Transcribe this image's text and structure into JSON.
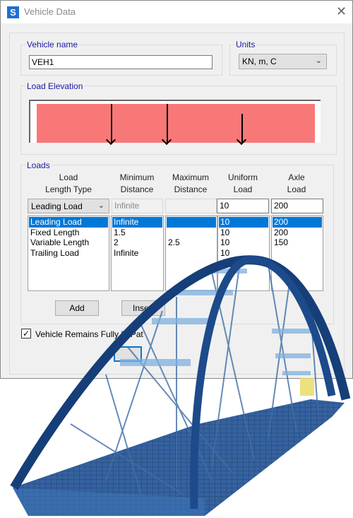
{
  "window": {
    "title": "Vehicle Data",
    "app_icon_letter": "S",
    "close_glyph": "✕"
  },
  "vehicle_name": {
    "label": "Vehicle name",
    "value": "VEH1"
  },
  "units": {
    "label": "Units",
    "value": "KN, m, C"
  },
  "load_elevation": {
    "label": "Load Elevation",
    "fill_color": "#f87878"
  },
  "loads": {
    "label": "Loads",
    "headers": {
      "type": [
        "Load",
        "Length Type"
      ],
      "min": [
        "Minimum",
        "Distance"
      ],
      "max": [
        "Maximum",
        "Distance"
      ],
      "uniform": [
        "Uniform",
        "Load"
      ],
      "axle": [
        "Axle",
        "Load"
      ]
    },
    "edit_row": {
      "type": "Leading Load",
      "min": "Infinite",
      "max": "",
      "uniform": "10",
      "axle": "200"
    },
    "rows": [
      {
        "type": "Leading Load",
        "min": "Infinite",
        "max": "",
        "uniform": "10",
        "axle": "200"
      },
      {
        "type": "Fixed Length",
        "min": "1.5",
        "max": "",
        "uniform": "10",
        "axle": "200"
      },
      {
        "type": "Variable Length",
        "min": "2",
        "max": "2.5",
        "uniform": "10",
        "axle": "150"
      },
      {
        "type": "Trailing Load",
        "min": "Infinite",
        "max": "",
        "uniform": "10",
        "axle": ""
      }
    ],
    "selected_row": 0,
    "buttons": {
      "add": "Add",
      "insert": "Insert"
    }
  },
  "remains_in_path": {
    "label": "Vehicle Remains Fully In Pat",
    "checked": true
  },
  "accent": "#0078d7"
}
